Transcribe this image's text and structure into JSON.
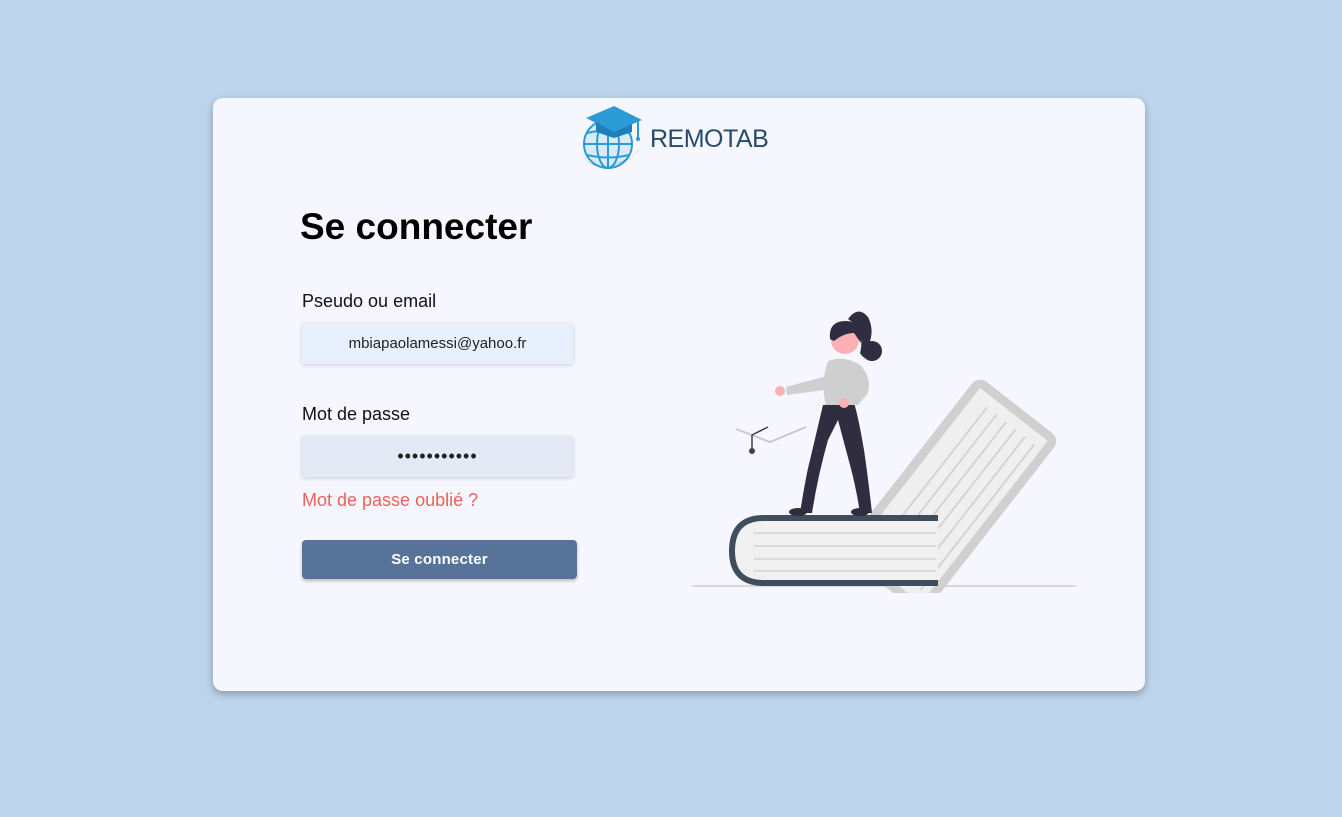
{
  "brand": {
    "name": "REMOTAB",
    "logo_icon": "globe-graduation-cap-icon"
  },
  "login": {
    "title": "Se connecter",
    "username_label": "Pseudo ou email",
    "username_value": "mbiapaolamessi@yahoo.fr",
    "password_label": "Mot de passe",
    "password_value": "***********",
    "forgot_password": "Mot de passe oublié ?",
    "submit_label": "Se connecter"
  },
  "colors": {
    "background": "#bdd4ea",
    "card": "#f6f7fe",
    "button": "#587399",
    "link": "#e9625c",
    "brand_text": "#264b6c"
  },
  "illustration": {
    "icon": "woman-standing-on-books-illustration"
  }
}
